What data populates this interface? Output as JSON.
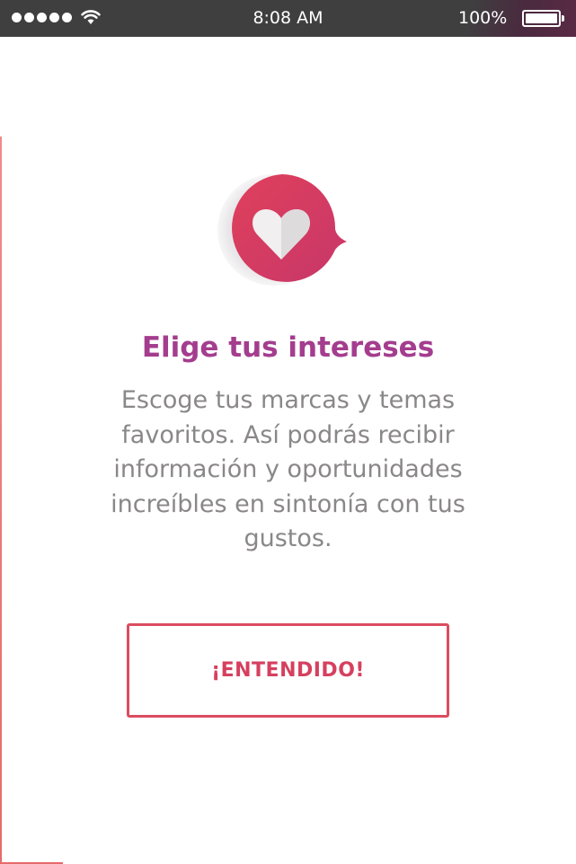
{
  "status_bar": {
    "time": "8:08 AM",
    "battery_percent": "100%",
    "battery_level": 1.0,
    "signal_icon": "signal-dots-icon",
    "wifi_icon": "wifi-icon",
    "battery_icon": "battery-icon"
  },
  "logo": {
    "icon": "heart-chat-bubble-icon",
    "colors": {
      "bubble_start": "#e0405b",
      "bubble_end": "#c7376a",
      "heart": "#f1eff0"
    }
  },
  "content": {
    "title": "Elige tus intereses",
    "description": "Escoge tus marcas y temas favoritos. Así podrás recibir información y oportunidades increíbles en sintonía con tus gustos."
  },
  "action": {
    "confirm_label": "¡ENTENDIDO!"
  },
  "colors": {
    "title": "#a43d8e",
    "body_text": "#8a8789",
    "button_border": "#dc4c60",
    "button_text": "#d6405f",
    "status_bar": "#3f3f40"
  }
}
